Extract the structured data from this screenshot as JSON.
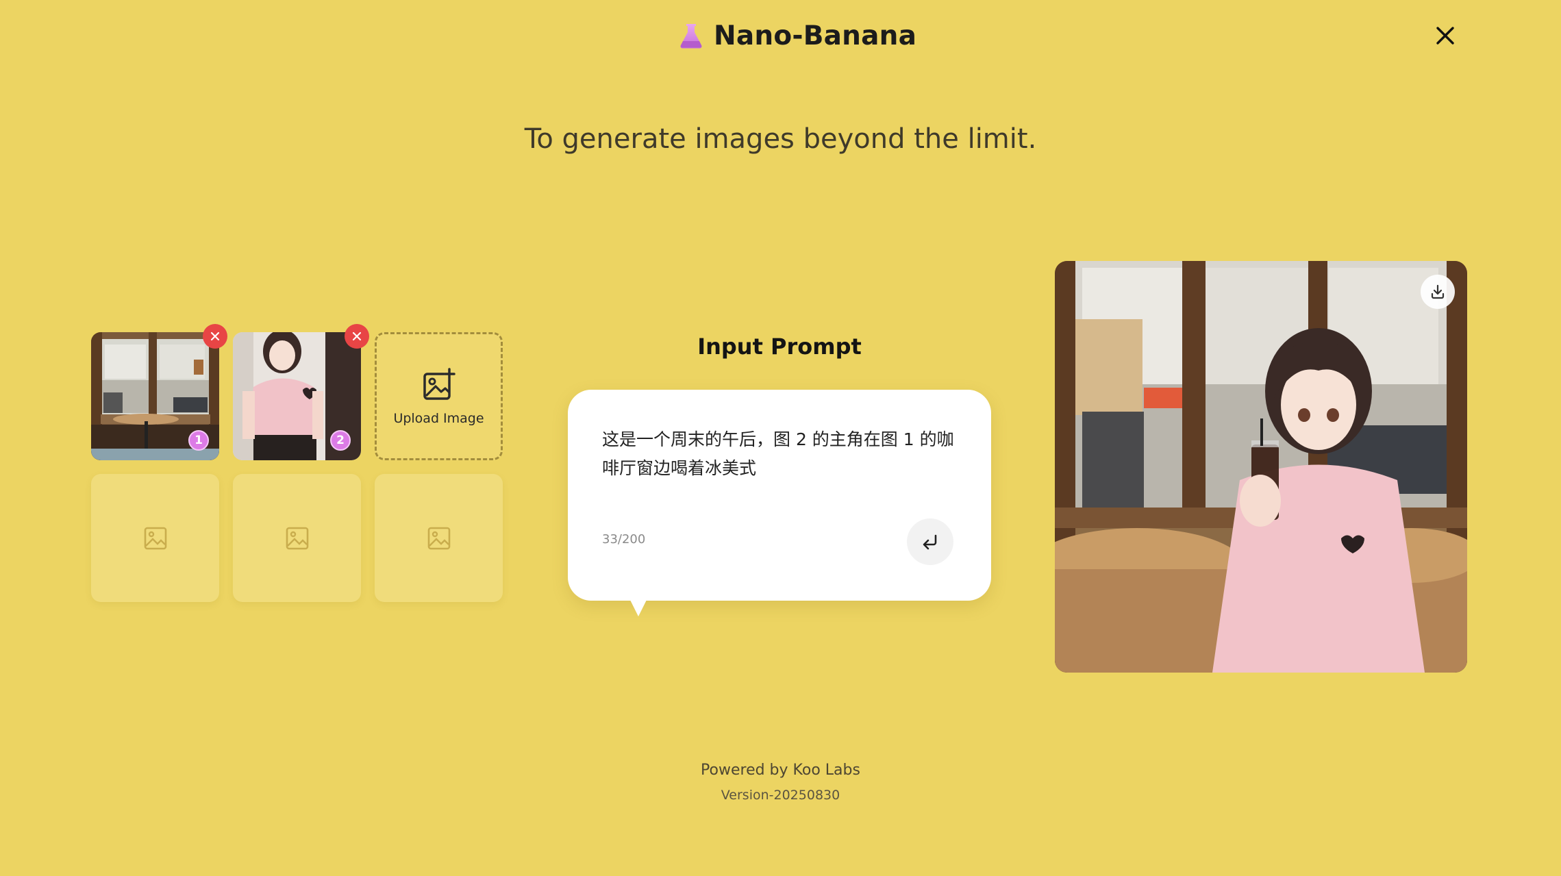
{
  "app": {
    "title": "Nano-Banana",
    "tagline": "To generate images beyond the limit."
  },
  "uploads": {
    "items": [
      {
        "index": "1",
        "alt": "cafe window photo"
      },
      {
        "index": "2",
        "alt": "anime girl in pink t-shirt"
      }
    ],
    "upload_label": "Upload Image"
  },
  "prompt": {
    "title": "Input Prompt",
    "text": "这是一个周末的午后，图 2 的主角在图 1 的咖啡厅窗边喝着冰美式",
    "char_count": "33/200"
  },
  "footer": {
    "powered": "Powered by Koo Labs",
    "version": "Version-20250830"
  },
  "colors": {
    "background": "#ecd462",
    "remove": "#e84545",
    "badge": "#dc7be6"
  },
  "icons": {
    "brand": "flask-icon",
    "close": "close-icon",
    "upload": "add-image-icon",
    "placeholder": "image-placeholder-icon",
    "send": "enter-icon",
    "download": "download-icon"
  }
}
